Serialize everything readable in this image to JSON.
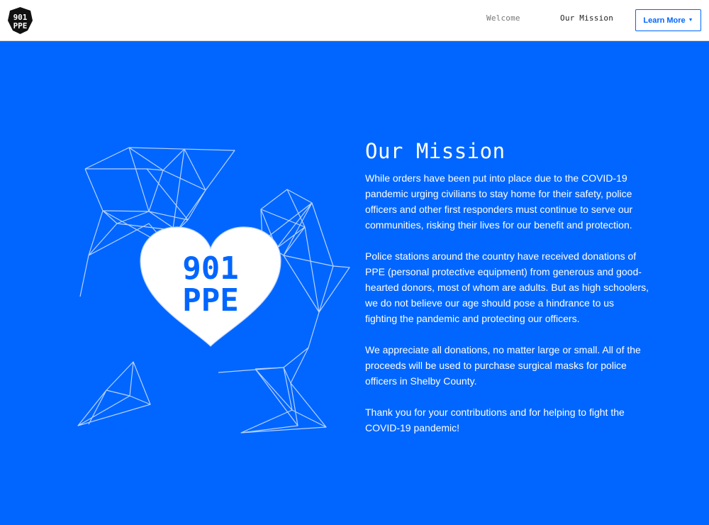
{
  "nav": {
    "logo_line1": "901",
    "logo_line2": "PPE",
    "welcome": "Welcome",
    "our_mission": "Our Mission",
    "learn_more": "Learn More"
  },
  "hero": {
    "heart_line1": "901",
    "heart_line2": "PPE",
    "heart_color": "#ffffff",
    "text_color": "#0066ff"
  },
  "mission": {
    "title": "Our Mission",
    "paragraphs": [
      "While orders have been put into place due to the COVID-19 pandemic urging civilians to stay home for their safety, police officers and other first responders must continue to serve our communities, risking their lives for our benefit and protection.",
      "Police stations around the country have received donations of PPE (personal protective equipment) from generous and good-hearted donors, most of whom are adults. But as high schoolers, we do not believe our age should pose a hindrance to us fighting the pandemic and protecting our officers.",
      "We appreciate all donations, no matter large or small. All of the proceeds will be used to purchase surgical masks for police officers in Shelby County.",
      "Thank you for your contributions and for helping to fight the COVID-19 pandemic!"
    ]
  },
  "colors": {
    "background": "#0066ff",
    "navbar": "#ffffff",
    "accent": "#0066ff",
    "wireframe": "#b8d2ff"
  },
  "icons": {
    "logo": "shield-badge-icon",
    "dropdown": "caret-down-icon"
  }
}
